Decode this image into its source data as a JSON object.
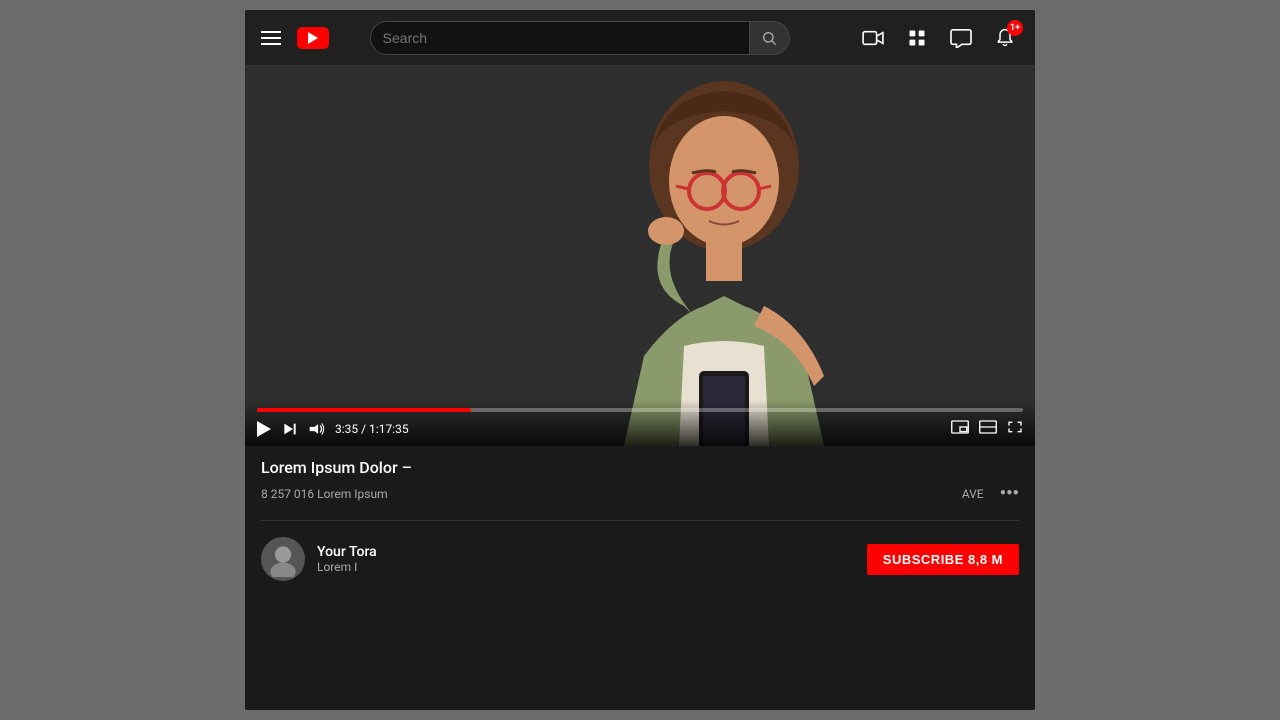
{
  "nav": {
    "search_placeholder": "Search",
    "hamburger_label": "Menu",
    "logo_label": "YouTube",
    "notification_count": "1+",
    "icons": {
      "camera": "📹",
      "grid": "⊞",
      "chat": "💬",
      "bell": "🔔"
    }
  },
  "video": {
    "title": "Lorem Ipsum Dolor –",
    "views": "8 257 016 Lorem Ipsum",
    "time_current": "3:35",
    "time_total": "1:17:35",
    "progress_percent": 28,
    "actions": {
      "save": "AVE",
      "more": "•••"
    }
  },
  "channel": {
    "name": "Your Tora",
    "description": "Lorem I",
    "subscribers": "8,8 M",
    "subscribe_label": "SUBSCRIBE  8,8 M"
  }
}
